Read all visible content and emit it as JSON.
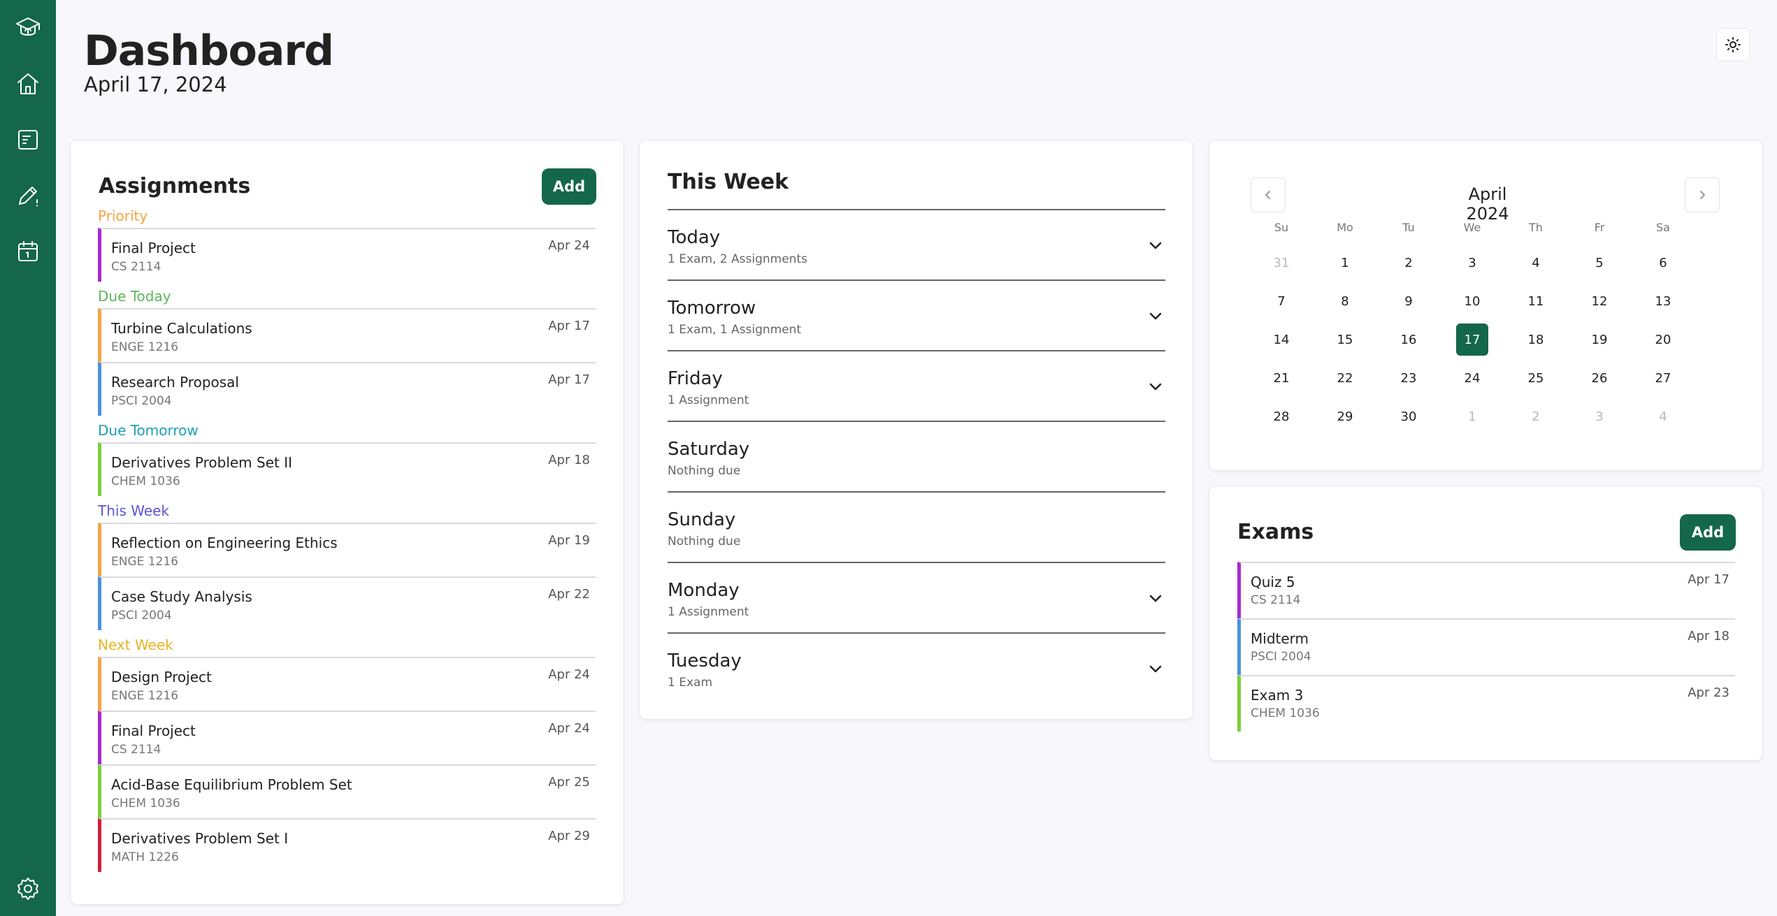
{
  "header": {
    "title": "Dashboard",
    "date": "April 17, 2024"
  },
  "sidebar": {
    "items": [
      {
        "icon": "graduation-cap-icon"
      },
      {
        "icon": "home-icon"
      },
      {
        "icon": "assignments-icon"
      },
      {
        "icon": "pencil-icon"
      },
      {
        "icon": "calendar-icon"
      },
      {
        "icon": "gear-icon"
      }
    ]
  },
  "assignments": {
    "title": "Assignments",
    "add_label": "Add",
    "groups": [
      {
        "label": "Priority",
        "color": "#f2a742",
        "items": [
          {
            "name": "Final Project",
            "course": "CS 2114",
            "due": "Apr 24",
            "color": "#a62ad4"
          }
        ]
      },
      {
        "label": "Due Today",
        "color": "#5cb85c",
        "items": [
          {
            "name": "Turbine Calculations",
            "course": "ENGE 1216",
            "due": "Apr 17",
            "color": "#f2a742"
          },
          {
            "name": "Research Proposal",
            "course": "PSCI 2004",
            "due": "Apr 17",
            "color": "#4b92dd"
          }
        ]
      },
      {
        "label": "Due Tomorrow",
        "color": "#1ba1b6",
        "items": [
          {
            "name": "Derivatives Problem Set II",
            "course": "CHEM 1036",
            "due": "Apr 18",
            "color": "#7ccf3a"
          }
        ]
      },
      {
        "label": "This Week",
        "color": "#5b56d6",
        "items": [
          {
            "name": "Reflection on Engineering Ethics",
            "course": "ENGE 1216",
            "due": "Apr 19",
            "color": "#f2a742"
          },
          {
            "name": "Case Study Analysis",
            "course": "PSCI 2004",
            "due": "Apr 22",
            "color": "#4b92dd"
          }
        ]
      },
      {
        "label": "Next Week",
        "color": "#e8b422",
        "items": [
          {
            "name": "Design Project",
            "course": "ENGE 1216",
            "due": "Apr 24",
            "color": "#f2a742"
          },
          {
            "name": "Final Project",
            "course": "CS 2114",
            "due": "Apr 24",
            "color": "#a62ad4"
          },
          {
            "name": "Acid-Base Equilibrium Problem Set",
            "course": "CHEM 1036",
            "due": "Apr 25",
            "color": "#7ccf3a"
          },
          {
            "name": "Derivatives Problem Set I",
            "course": "MATH 1226",
            "due": "Apr 29",
            "color": "#d0203a"
          }
        ]
      }
    ]
  },
  "this_week": {
    "title": "This Week",
    "days": [
      {
        "day": "Today",
        "summary": "1 Exam, 2 Assignments",
        "expandable": true
      },
      {
        "day": "Tomorrow",
        "summary": "1 Exam, 1 Assignment",
        "expandable": true
      },
      {
        "day": "Friday",
        "summary": "1 Assignment",
        "expandable": true
      },
      {
        "day": "Saturday",
        "summary": "Nothing due",
        "expandable": false
      },
      {
        "day": "Sunday",
        "summary": "Nothing due",
        "expandable": false
      },
      {
        "day": "Monday",
        "summary": "1 Assignment",
        "expandable": true
      },
      {
        "day": "Tuesday",
        "summary": "1 Exam",
        "expandable": true
      }
    ]
  },
  "calendar": {
    "month_label": "April 2024",
    "weekdays": [
      "Su",
      "Mo",
      "Tu",
      "We",
      "Th",
      "Fr",
      "Sa"
    ],
    "selected": "17",
    "weeks": [
      [
        {
          "d": "31",
          "m": true
        },
        {
          "d": "1"
        },
        {
          "d": "2"
        },
        {
          "d": "3"
        },
        {
          "d": "4"
        },
        {
          "d": "5"
        },
        {
          "d": "6"
        }
      ],
      [
        {
          "d": "7"
        },
        {
          "d": "8"
        },
        {
          "d": "9"
        },
        {
          "d": "10"
        },
        {
          "d": "11"
        },
        {
          "d": "12"
        },
        {
          "d": "13"
        }
      ],
      [
        {
          "d": "14"
        },
        {
          "d": "15"
        },
        {
          "d": "16"
        },
        {
          "d": "17"
        },
        {
          "d": "18"
        },
        {
          "d": "19"
        },
        {
          "d": "20"
        }
      ],
      [
        {
          "d": "21"
        },
        {
          "d": "22"
        },
        {
          "d": "23"
        },
        {
          "d": "24"
        },
        {
          "d": "25"
        },
        {
          "d": "26"
        },
        {
          "d": "27"
        }
      ],
      [
        {
          "d": "28"
        },
        {
          "d": "29"
        },
        {
          "d": "30"
        },
        {
          "d": "1",
          "m": true
        },
        {
          "d": "2",
          "m": true
        },
        {
          "d": "3",
          "m": true
        },
        {
          "d": "4",
          "m": true
        }
      ]
    ]
  },
  "exams": {
    "title": "Exams",
    "add_label": "Add",
    "items": [
      {
        "name": "Quiz 5",
        "course": "CS 2114",
        "due": "Apr 17",
        "color": "#a62ad4"
      },
      {
        "name": "Midterm",
        "course": "PSCI 2004",
        "due": "Apr 18",
        "color": "#4b92dd"
      },
      {
        "name": "Exam 3",
        "course": "CHEM 1036",
        "due": "Apr 23",
        "color": "#7ccf3a"
      }
    ]
  },
  "colors": {
    "brand": "#14674a",
    "background": "#f7f7fc"
  }
}
